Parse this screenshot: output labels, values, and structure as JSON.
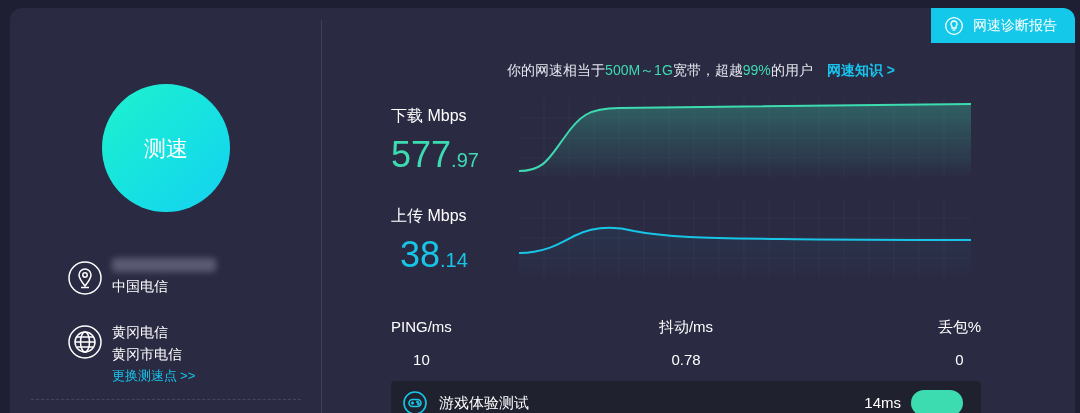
{
  "report_button": {
    "label": "网速诊断报告"
  },
  "summary": {
    "segments": [
      {
        "text": "你的网速相当于",
        "highlight": false
      },
      {
        "text": "500M～1G",
        "highlight": true
      },
      {
        "text": "宽带，超越",
        "highlight": false
      },
      {
        "text": "99%",
        "highlight": true
      },
      {
        "text": "的用户",
        "highlight": false
      }
    ],
    "link": "网速知识 >"
  },
  "speed_test_button": {
    "label": "测速"
  },
  "isp": {
    "label": "中国电信"
  },
  "server": {
    "name": "黄冈电信",
    "location": "黄冈市电信",
    "change_link": "更换测速点 >>"
  },
  "speeds": [
    {
      "kind": "download",
      "label": "下载 Mbps",
      "integer": "577",
      "decimal": ".97",
      "color": "#3ddbb0"
    },
    {
      "kind": "upload",
      "label": "上传 Mbps",
      "integer": "38",
      "decimal": ".14",
      "color": "#17c6e6"
    }
  ],
  "stats": [
    {
      "label": "PING/ms",
      "value": "10"
    },
    {
      "label": "抖动/ms",
      "value": "0.78"
    },
    {
      "label": "丢包%",
      "value": "0"
    }
  ],
  "game_test": {
    "label": "游戏体验测试",
    "latency": "14ms"
  }
}
